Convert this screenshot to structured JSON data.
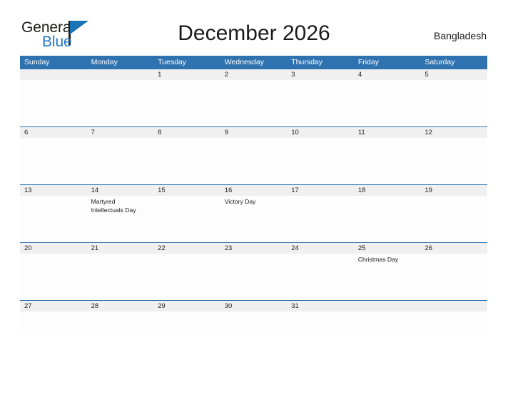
{
  "brand": {
    "name_part1": "General",
    "name_part2": "Blue",
    "flag_icon": "blue-triangle-flag-icon",
    "accent_color": "#2176c7"
  },
  "header": {
    "title": "December 2026",
    "region": "Bangladesh"
  },
  "theme": {
    "header_blue": "#2e72b0",
    "date_row_bg": "#f0f0f0",
    "cell_bg": "#fdfdfd",
    "text_color": "#1a1a1a"
  },
  "calendar": {
    "month": "December",
    "year": "2026",
    "day_headers": [
      "Sunday",
      "Monday",
      "Tuesday",
      "Wednesday",
      "Thursday",
      "Friday",
      "Saturday"
    ],
    "weeks": [
      {
        "dates": [
          "",
          "",
          "1",
          "2",
          "3",
          "4",
          "5"
        ],
        "events": [
          "",
          "",
          "",
          "",
          "",
          "",
          ""
        ]
      },
      {
        "dates": [
          "6",
          "7",
          "8",
          "9",
          "10",
          "11",
          "12"
        ],
        "events": [
          "",
          "",
          "",
          "",
          "",
          "",
          ""
        ]
      },
      {
        "dates": [
          "13",
          "14",
          "15",
          "16",
          "17",
          "18",
          "19"
        ],
        "events": [
          "",
          "Martyred Intellectuals Day",
          "",
          "Victory Day",
          "",
          "",
          ""
        ]
      },
      {
        "dates": [
          "20",
          "21",
          "22",
          "23",
          "24",
          "25",
          "26"
        ],
        "events": [
          "",
          "",
          "",
          "",
          "",
          "Christmas Day",
          ""
        ]
      },
      {
        "dates": [
          "27",
          "28",
          "29",
          "30",
          "31",
          "",
          ""
        ],
        "events": [
          "",
          "",
          "",
          "",
          "",
          "",
          ""
        ]
      }
    ]
  }
}
